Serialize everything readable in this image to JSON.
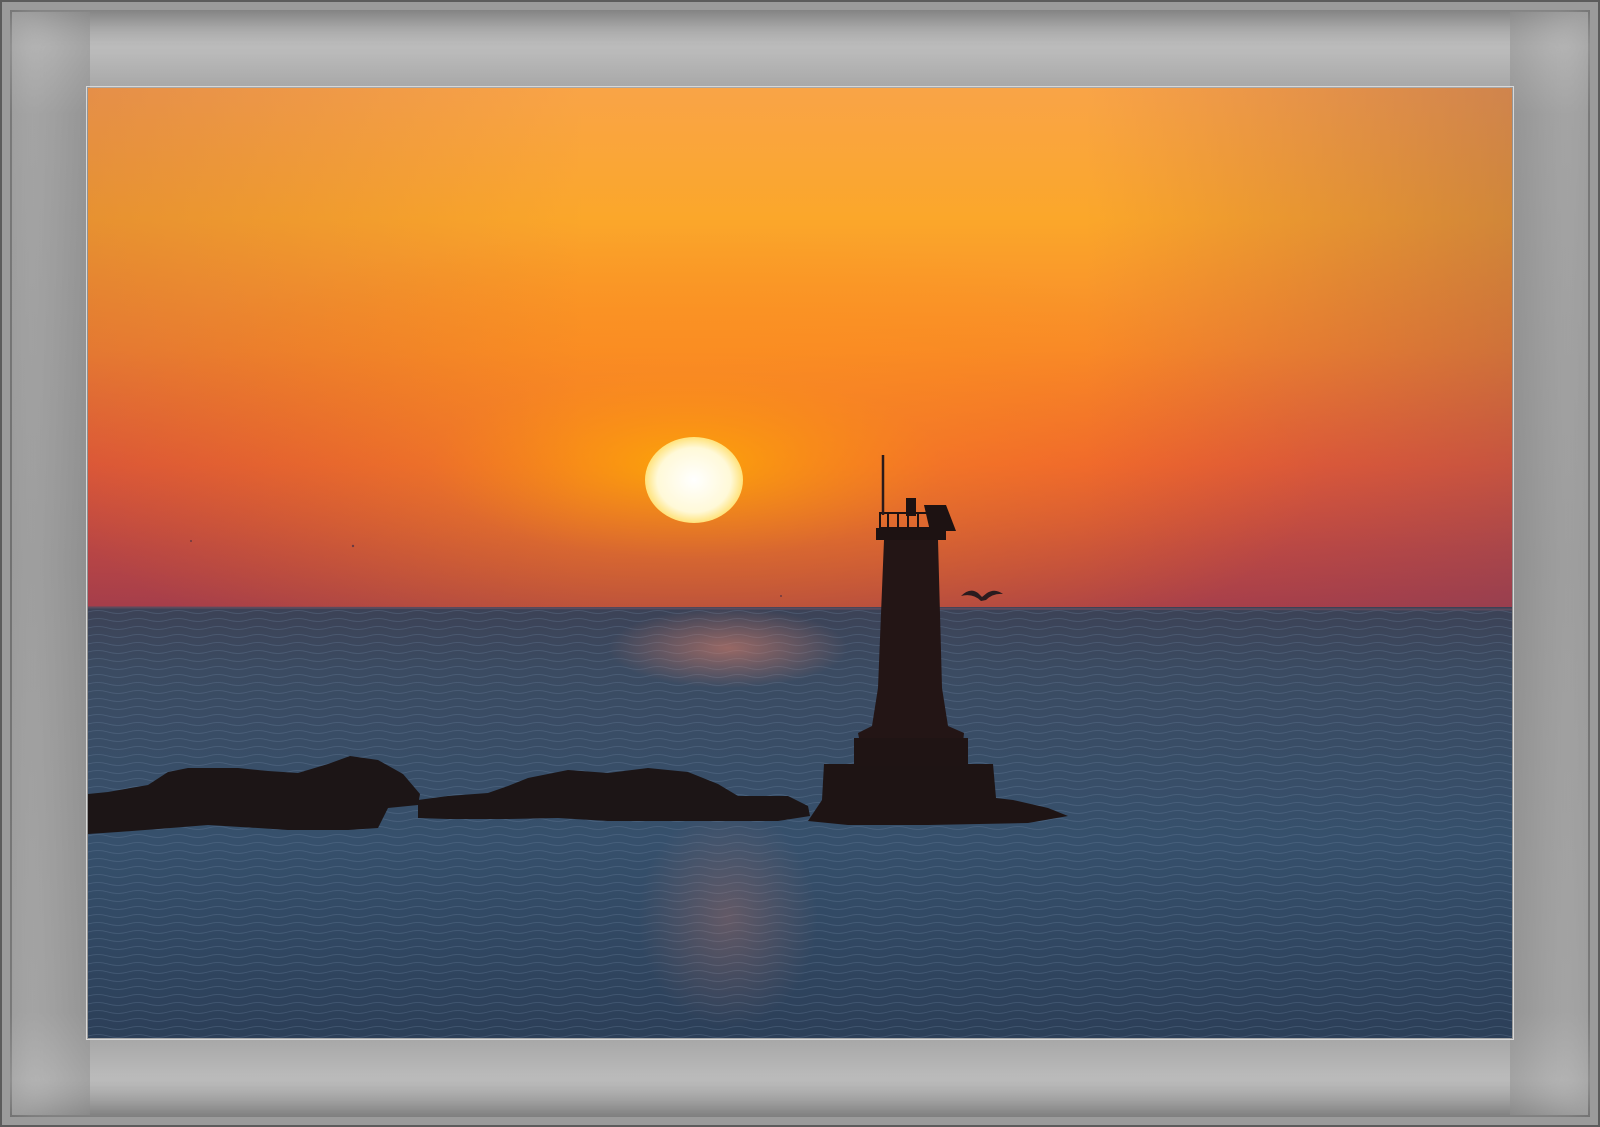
{
  "photo": {
    "subject": "sunrise-over-sea-with-lighthouse",
    "palette": {
      "sky_top": "#f79a3e",
      "sky_mid": "#fba71c",
      "sky_low": "#ef6a2e",
      "horizon_haze": "#b44a44",
      "sea": "#2f3f57",
      "sea_light": "#4b6079",
      "sun": "#fffdf0",
      "silhouette": "#1e1414",
      "frame": "#9a9a9a"
    }
  }
}
